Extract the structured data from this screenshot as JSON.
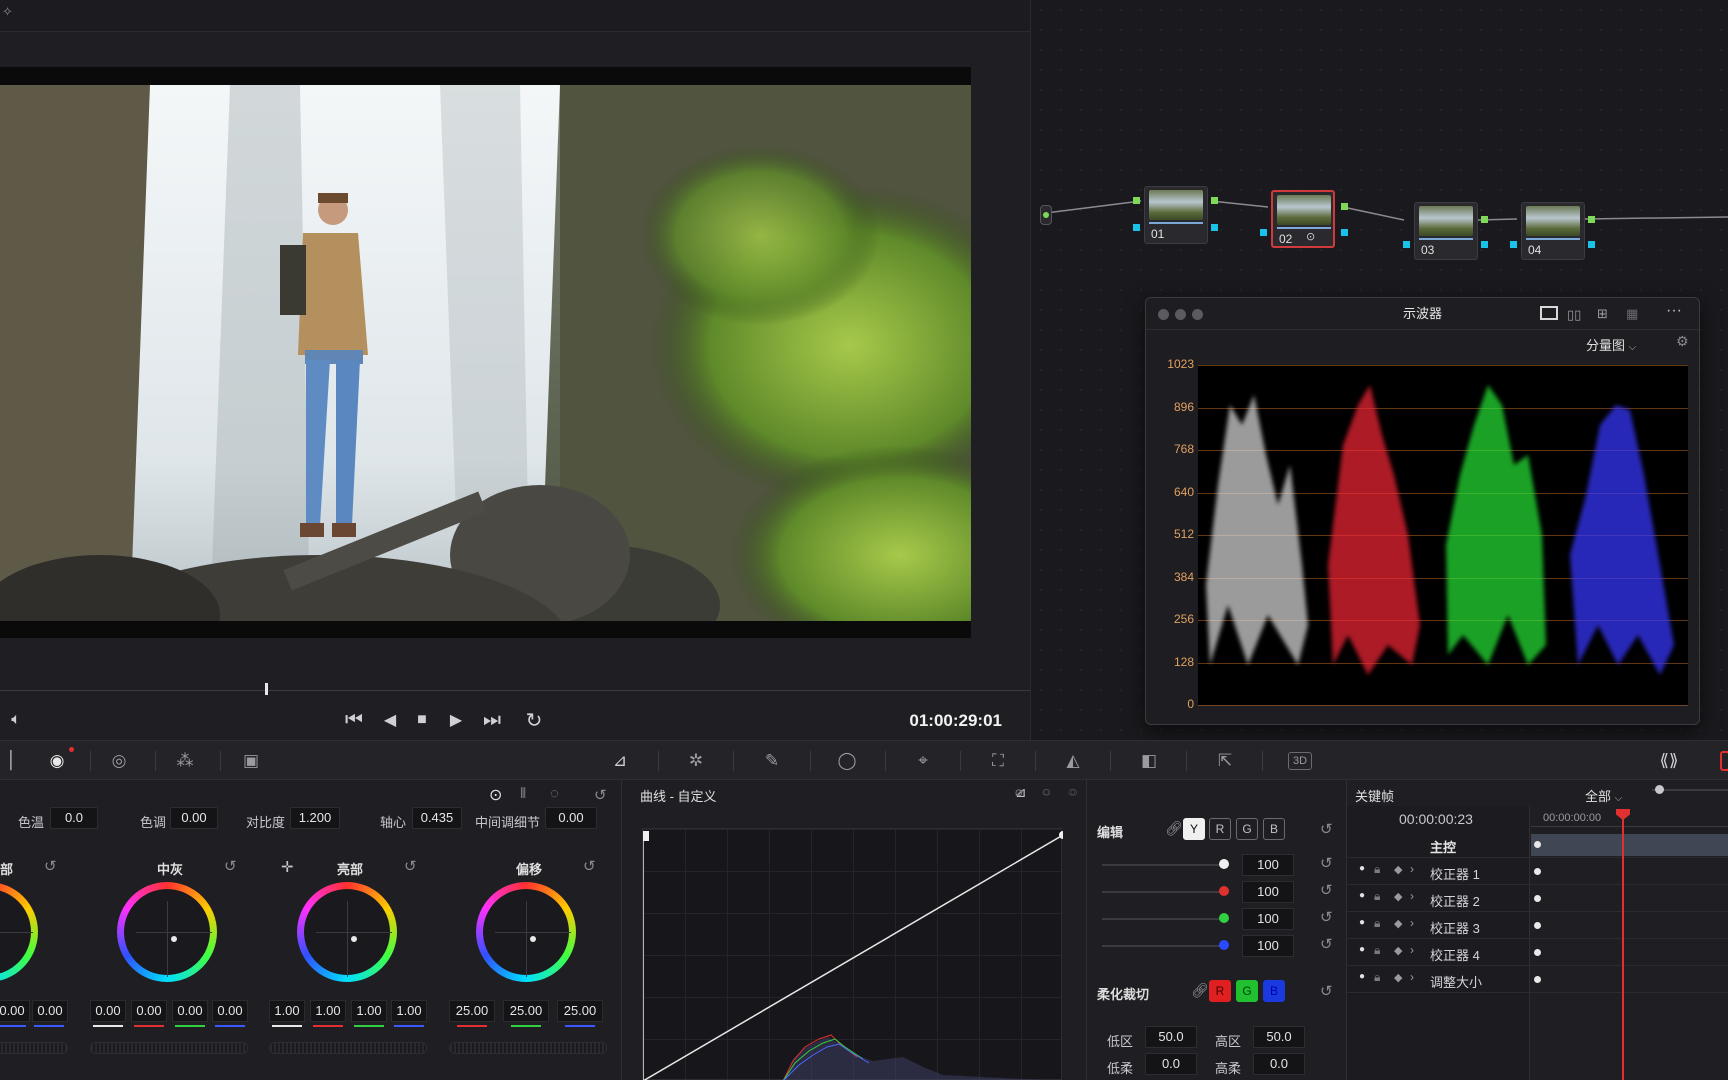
{
  "viewer": {
    "timecode": "01:00:29:01"
  },
  "nodes": [
    {
      "label": "01"
    },
    {
      "label": "02"
    },
    {
      "label": "03"
    },
    {
      "label": "04"
    }
  ],
  "scope": {
    "title": "示波器",
    "mode": "分量图",
    "y_labels": [
      "1023",
      "896",
      "768",
      "640",
      "512",
      "384",
      "256",
      "128",
      "0"
    ]
  },
  "primaries": {
    "temp_label": "色温",
    "temp_value": "0.0",
    "tint_label": "色调",
    "tint_value": "0.00",
    "contrast_label": "对比度",
    "contrast_value": "1.200",
    "pivot_label": "轴心",
    "pivot_value": "0.435",
    "middetail_label": "中间调细节",
    "middetail_value": "0.00",
    "wheels": [
      {
        "title": "部",
        "values": [
          "0.00",
          "0.00"
        ]
      },
      {
        "title": "中灰",
        "values": [
          "0.00",
          "0.00",
          "0.00",
          "0.00"
        ]
      },
      {
        "title": "亮部",
        "values": [
          "1.00",
          "1.00",
          "1.00",
          "1.00"
        ]
      },
      {
        "title": "偏移",
        "values": [
          "25.00",
          "25.00",
          "25.00"
        ]
      }
    ]
  },
  "curves": {
    "title": "曲线 - 自定义"
  },
  "edit": {
    "title": "编辑",
    "channels": [
      "Y",
      "R",
      "G",
      "B"
    ],
    "values": [
      "100",
      "100",
      "100",
      "100"
    ],
    "soft_clip_title": "柔化裁切",
    "soft_clip_buttons": [
      "R",
      "G",
      "B"
    ],
    "low_label": "低区",
    "low_value": "50.0",
    "high_label": "高区",
    "high_value": "50.0",
    "low_soft_label": "低柔",
    "low_soft_value": "0.0",
    "high_soft_label": "高柔",
    "high_soft_value": "0.0"
  },
  "keyframes": {
    "title": "关键帧",
    "filter": "全部",
    "current_time": "00:00:00:23",
    "ruler_time": "00:00:00:00",
    "master": "主控",
    "rows": [
      "校正器 1",
      "校正器 2",
      "校正器 3",
      "校正器 4",
      "调整大小"
    ]
  },
  "colors": {
    "accent_red": "#e03030",
    "node_green": "#7ed957",
    "node_blue": "#19c2e8",
    "panel_bg": "#1f1f23"
  }
}
